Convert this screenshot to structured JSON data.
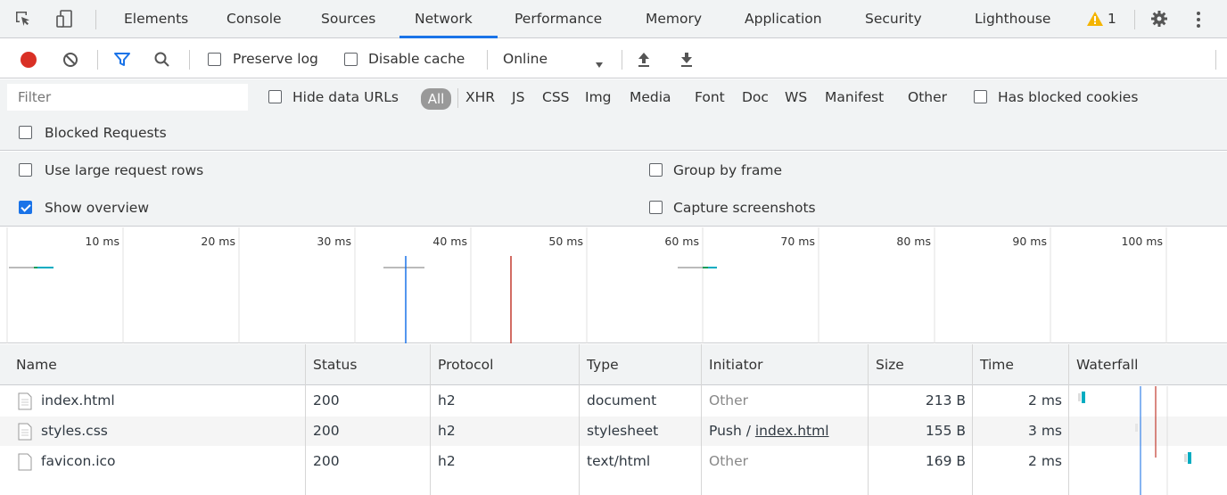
{
  "tabs": {
    "items": [
      "Elements",
      "Console",
      "Sources",
      "Network",
      "Performance",
      "Memory",
      "Application",
      "Security",
      "Lighthouse"
    ],
    "active": "Network",
    "warning_count": "1"
  },
  "toolbar": {
    "preserve_log": "Preserve log",
    "disable_cache": "Disable cache",
    "throttling": "Online"
  },
  "filter": {
    "placeholder": "Filter",
    "hide_data_urls": "Hide data URLs",
    "types": [
      "All",
      "XHR",
      "JS",
      "CSS",
      "Img",
      "Media",
      "Font",
      "Doc",
      "WS",
      "Manifest",
      "Other"
    ],
    "active_type": "All",
    "has_blocked_cookies": "Has blocked cookies",
    "blocked_requests": "Blocked Requests"
  },
  "settings": {
    "use_large_rows": "Use large request rows",
    "show_overview": "Show overview",
    "show_overview_checked": true,
    "group_by_frame": "Group by frame",
    "capture_screenshots": "Capture screenshots"
  },
  "overview": {
    "ticks": [
      "10 ms",
      "20 ms",
      "30 ms",
      "40 ms",
      "50 ms",
      "60 ms",
      "70 ms",
      "80 ms",
      "90 ms",
      "100 ms"
    ],
    "dom_content_loaded_color": "#1a73e8",
    "load_color": "#c23b30"
  },
  "table": {
    "columns": [
      "Name",
      "Status",
      "Protocol",
      "Type",
      "Initiator",
      "Size",
      "Time",
      "Waterfall"
    ],
    "rows": [
      {
        "name": "index.html",
        "status": "200",
        "protocol": "h2",
        "type": "document",
        "initiator": "Other",
        "initiator_link": "",
        "size": "213 B",
        "time": "2 ms"
      },
      {
        "name": "styles.css",
        "status": "200",
        "protocol": "h2",
        "type": "stylesheet",
        "initiator": "Push / ",
        "initiator_link": "index.html",
        "size": "155 B",
        "time": "3 ms"
      },
      {
        "name": "favicon.ico",
        "status": "200",
        "protocol": "h2",
        "type": "text/html",
        "initiator": "Other",
        "initiator_link": "",
        "size": "169 B",
        "time": "2 ms"
      }
    ]
  }
}
